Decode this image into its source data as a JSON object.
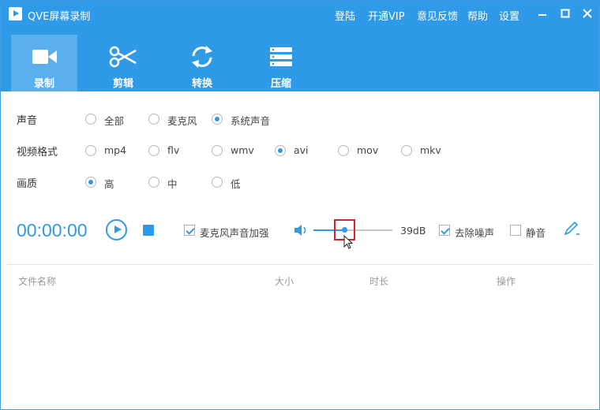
{
  "app": {
    "title": "QVE屏幕录制"
  },
  "toplinks": [
    "登陆",
    "开通VIP",
    "意见反馈",
    "帮助",
    "设置"
  ],
  "window_controls": {
    "minimize": "−",
    "maximize": "□",
    "close": "✕"
  },
  "tabs": [
    {
      "label": "录制",
      "icon": "video-camera-icon",
      "active": true
    },
    {
      "label": "剪辑",
      "icon": "scissors-icon",
      "active": false
    },
    {
      "label": "转换",
      "icon": "convert-refresh-icon",
      "active": false
    },
    {
      "label": "压缩",
      "icon": "compress-stack-icon",
      "active": false
    }
  ],
  "settings": {
    "sound": {
      "label": "声音",
      "options": [
        "全部",
        "麦克风",
        "系统声音"
      ],
      "selected": "系统声音"
    },
    "format": {
      "label": "视频格式",
      "options": [
        "mp4",
        "flv",
        "wmv",
        "avi",
        "mov",
        "mkv"
      ],
      "selected": "avi"
    },
    "quality": {
      "label": "画质",
      "options": [
        "高",
        "中",
        "低"
      ],
      "selected": "高"
    }
  },
  "controls": {
    "timer": "00:00:00",
    "mic_boost_label": "麦克风声音加强",
    "mic_boost_checked": true,
    "volume_level": 0.38,
    "volume_db": "39dB",
    "denoise_label": "去除噪声",
    "denoise_checked": true,
    "mute_label": "静音",
    "mute_checked": false
  },
  "file_table": {
    "columns": [
      "文件名称",
      "大小",
      "时长",
      "操作"
    ]
  },
  "colors": {
    "accent": "#2f9ae8",
    "highlight_box": "#d9232a"
  }
}
